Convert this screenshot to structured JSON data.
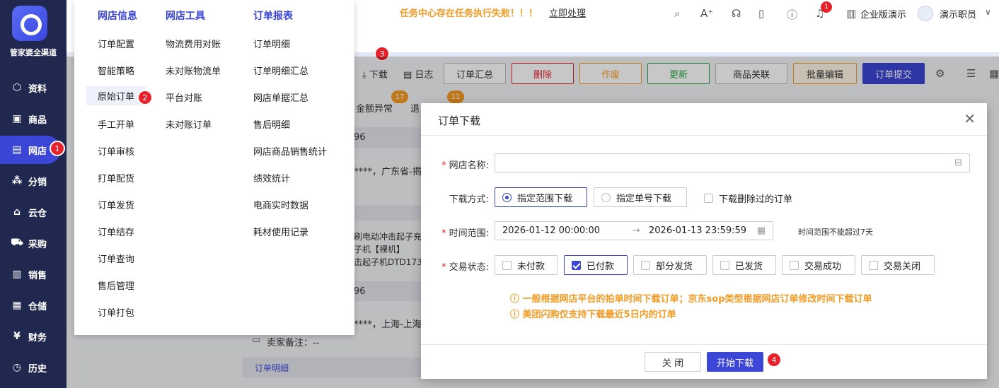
{
  "sidebar": {
    "brand": "管家婆全渠道",
    "items": [
      {
        "label": "资料",
        "icon": "cube-icon"
      },
      {
        "label": "商品",
        "icon": "box-icon"
      },
      {
        "label": "网店",
        "icon": "document-icon"
      },
      {
        "label": "分销",
        "icon": "network-icon"
      },
      {
        "label": "云仓",
        "icon": "cloud-home-icon"
      },
      {
        "label": "采购",
        "icon": "cart-icon"
      },
      {
        "label": "销售",
        "icon": "bar-chart-icon"
      },
      {
        "label": "仓储",
        "icon": "warehouse-icon"
      },
      {
        "label": "财务",
        "icon": "finance-icon"
      },
      {
        "label": "历史",
        "icon": "clock-icon"
      }
    ],
    "badge": "1"
  },
  "topbar": {
    "alert": "任务中心存在任务执行失败！！！",
    "alert_link": "立即处理",
    "notif_count": "1",
    "company": "企业版演示",
    "user": "演示职员"
  },
  "menu": {
    "col1_title": "网店信息",
    "col1": [
      "订单配置",
      "智能策略",
      "原始订单",
      "手工开单",
      "订单审核",
      "打单配货",
      "订单发货",
      "订单结存",
      "订单查询",
      "售后管理",
      "订单打包"
    ],
    "col2_title": "网店工具",
    "col2": [
      "物流费用对账",
      "未对账物流单",
      "平台对账",
      "未对账订单"
    ],
    "col3_title": "订单报表",
    "col3": [
      "订单明细",
      "订单明细汇总",
      "网店单据汇总",
      "售后明细",
      "网店商品销售统计",
      "绩效统计",
      "电商实时数据",
      "耗材使用记录"
    ],
    "badge": "2"
  },
  "toolbar": {
    "download": "下载",
    "log": "日志",
    "summary": "订单汇总",
    "delete": "删除",
    "void": "作废",
    "update": "更新",
    "product_link": "商品关联",
    "batch_edit": "批量编辑",
    "submit": "订单提交",
    "badge": "3"
  },
  "background": {
    "tab_badge1": "17",
    "tab_badge2": "11",
    "amount_abnormal": "金额异常",
    "return_tab": "退",
    "addr1": "****，广东省-揭阳",
    "item1": "刷电动冲击起子充",
    "item2": "子机【裸机】",
    "item3": "击起子机DTD173【",
    "addr2": "****，上海-上海市",
    "seller_note": "卖家备注：--",
    "order_detail": "订单明细",
    "num1": "96",
    "num2": "96"
  },
  "dialog": {
    "title": "订单下载",
    "shop_label": "网店名称:",
    "shop_value": "",
    "mode_label": "下载方式:",
    "mode_range": "指定范围下载",
    "mode_number": "指定单号下载",
    "include_deleted": "下载删除过的订单",
    "time_label": "时间范围:",
    "time_start": "2026-01-12 00:00:00",
    "time_end": "2026-01-13 23:59:59",
    "time_hint": "时间范围不能超过7天",
    "status_label": "交易状态:",
    "statuses": [
      {
        "label": "未付款",
        "checked": false
      },
      {
        "label": "已付款",
        "checked": true
      },
      {
        "label": "部分发货",
        "checked": false
      },
      {
        "label": "已发货",
        "checked": false
      },
      {
        "label": "交易成功",
        "checked": false
      },
      {
        "label": "交易关闭",
        "checked": false
      }
    ],
    "note1": "一般根据网店平台的拍单时间下载订单；京东sop类型根据网店订单修改时间下载订单",
    "note2": "美团闪购仅支持下载最近5日内的订单",
    "close_btn": "关 闭",
    "start_btn": "开始下载",
    "badge": "4"
  },
  "colors": {
    "sidebar_bg": "#20284f",
    "accent": "#3b45d6",
    "warn": "#f59a23",
    "badge": "#e8212b"
  }
}
